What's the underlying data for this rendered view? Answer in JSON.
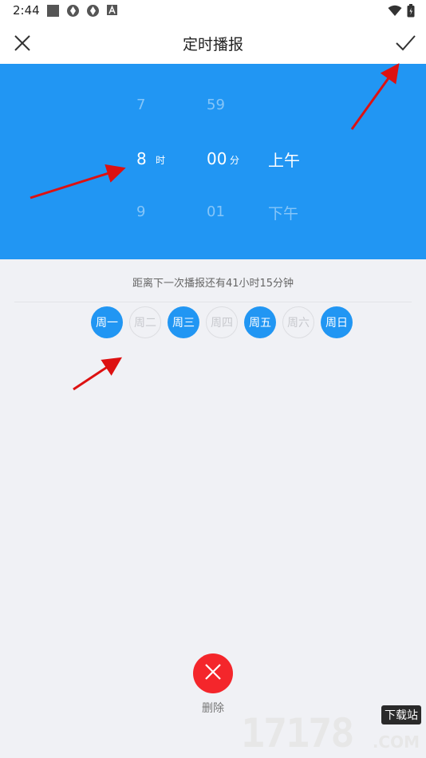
{
  "status_bar": {
    "time": "2:44"
  },
  "header": {
    "title": "定时播报"
  },
  "picker": {
    "hour": {
      "prev": "7",
      "current": "8",
      "next": "9",
      "unit": "时"
    },
    "minute": {
      "prev": "59",
      "current": "00",
      "next": "01",
      "unit": "分"
    },
    "ampm": {
      "current": "上午",
      "next": "下午"
    }
  },
  "countdown": "距离下一次播报还有41小时15分钟",
  "days": [
    {
      "label": "周一",
      "selected": true
    },
    {
      "label": "周二",
      "selected": false
    },
    {
      "label": "周三",
      "selected": true
    },
    {
      "label": "周四",
      "selected": false
    },
    {
      "label": "周五",
      "selected": true
    },
    {
      "label": "周六",
      "selected": false
    },
    {
      "label": "周日",
      "selected": true
    }
  ],
  "delete": {
    "label": "删除"
  },
  "watermark": {
    "digits": "17178",
    "tag": "下载站",
    "suffix": ".COM"
  },
  "colors": {
    "accent": "#2196f3",
    "danger": "#f4262b",
    "background": "#f0f1f5"
  }
}
